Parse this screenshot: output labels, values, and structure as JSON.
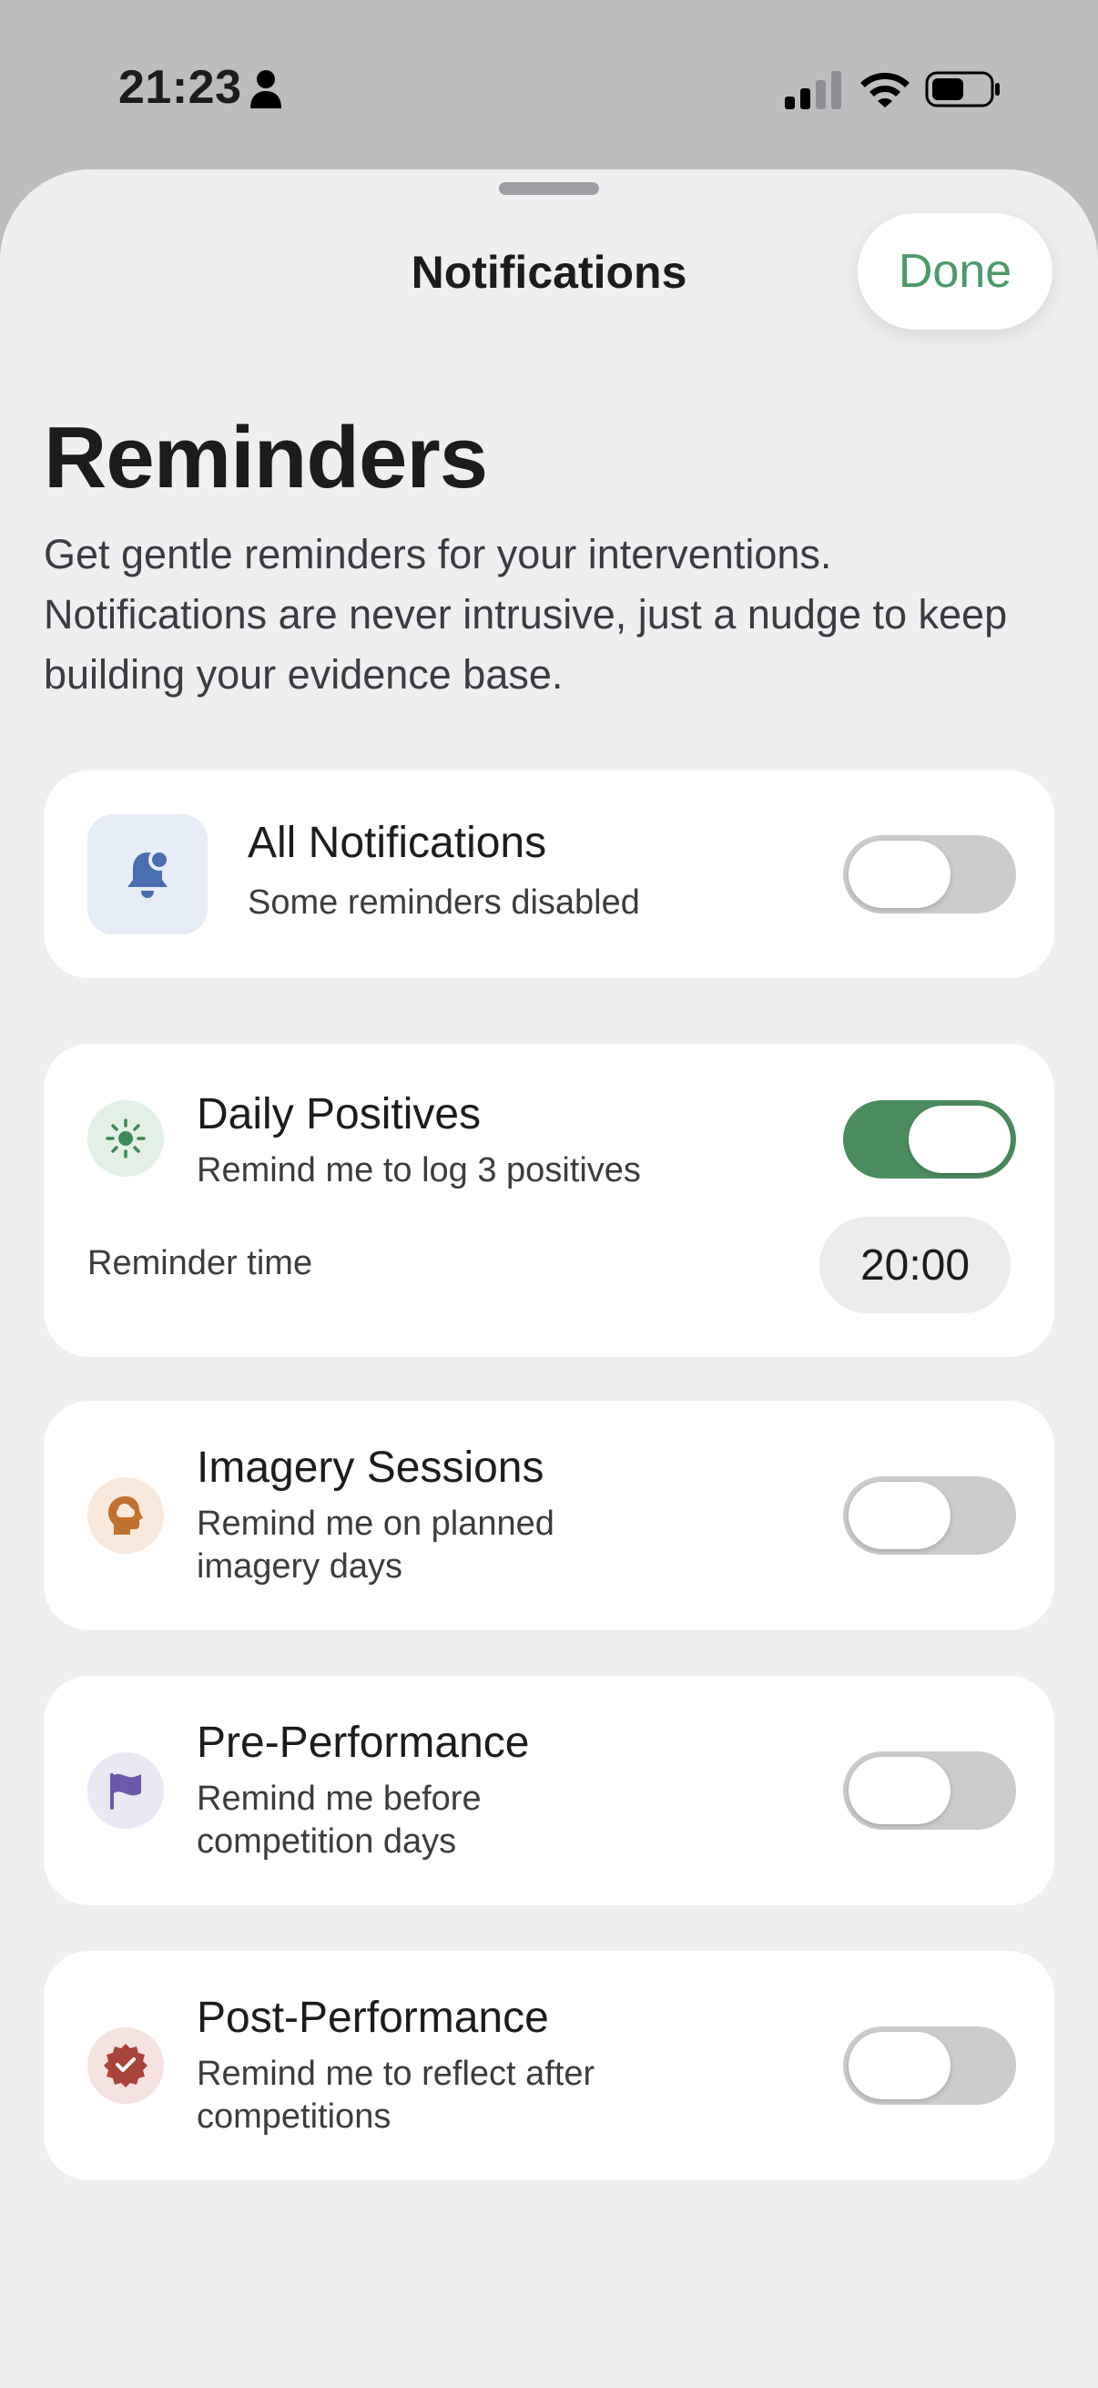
{
  "status_bar": {
    "time": "21:23",
    "icons": [
      "person-icon",
      "cellular-signal-icon",
      "wifi-icon",
      "battery-icon"
    ]
  },
  "header": {
    "title": "Notifications",
    "done_label": "Done"
  },
  "page": {
    "heading": "Reminders",
    "description": "Get gentle reminders for your interventions. Notifications are never intrusive, just a nudge to keep building your evidence base."
  },
  "all_notifications": {
    "title": "All Notifications",
    "subtitle": "Some reminders disabled",
    "enabled": false,
    "icon": "bell-badge-icon"
  },
  "reminders": [
    {
      "title": "Daily Positives",
      "subtitle": "Remind me to log 3 positives",
      "enabled": true,
      "icon": "sun-icon",
      "reminder_time_label": "Reminder time",
      "reminder_time": "20:00"
    },
    {
      "title": "Imagery Sessions",
      "subtitle": "Remind me on planned imagery days",
      "enabled": false,
      "icon": "brain-head-icon"
    },
    {
      "title": "Pre-Performance",
      "subtitle": "Remind me before competition days",
      "enabled": false,
      "icon": "flag-icon"
    },
    {
      "title": "Post-Performance",
      "subtitle": "Remind me to reflect after competitions",
      "enabled": false,
      "icon": "checkmark-seal-icon"
    }
  ],
  "colors": {
    "accent_green": "#4b8c5f",
    "done_text": "#4a9a6a",
    "toggle_off": "#cbcbcd",
    "bell_blue": "#4a6fb0",
    "sun_green": "#3d8a58",
    "brain_orange": "#c0712f",
    "flag_purple": "#6a5aa8",
    "seal_red": "#a8443a"
  }
}
